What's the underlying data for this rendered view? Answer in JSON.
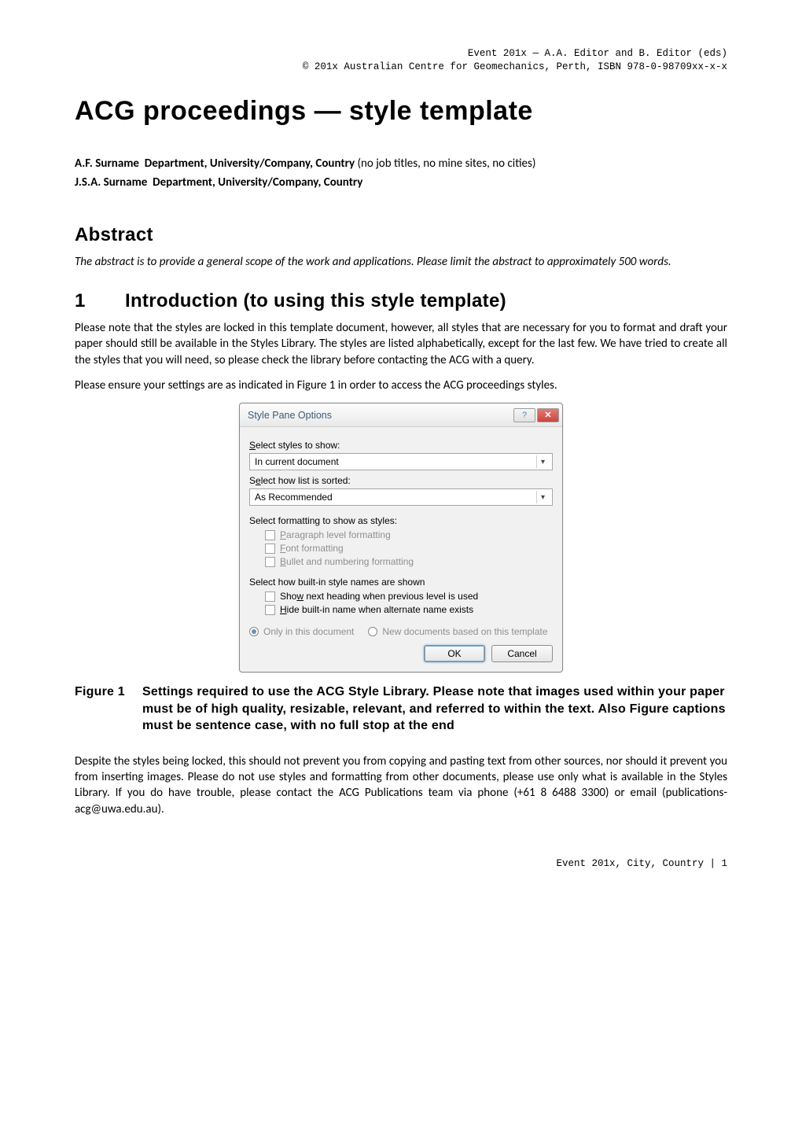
{
  "header": {
    "line1_prefix": "Event 201x ",
    "line1_dash": "—",
    "line1_suffix": " A.A. Editor and B. Editor (eds)",
    "line2": "© 201x Australian Centre for Geomechanics, Perth, ISBN 978-0-98709xx-x-x"
  },
  "title": "ACG proceedings — style template",
  "authors": [
    {
      "name": "A.F. Surname",
      "affiliation": "Department, University/Company, Country",
      "note": " (no job titles, no mine sites, no cities)"
    },
    {
      "name": "J.S.A. Surname",
      "affiliation": "Department, University/Company, Country",
      "note": ""
    }
  ],
  "abstract": {
    "heading": "Abstract",
    "text": "The abstract is to provide a general scope of the work and applications. Please limit the abstract to approximately 500 words."
  },
  "section1": {
    "number": "1",
    "heading": "Introduction (to using this style template)",
    "p1": "Please note that the styles are locked in this template document, however, all styles that are necessary for you to format and draft your paper should still be available in the Styles Library. The styles are listed alphabetically, except for the last few. We have tried to create all the styles that you will need, so please check the library before contacting the ACG with a query.",
    "p2": "Please ensure your settings are as indicated in Figure 1 in order to access the ACG proceedings styles."
  },
  "dialog": {
    "title": "Style Pane Options",
    "help_icon": "?",
    "close_icon": "✕",
    "label_select_styles_pre": "S",
    "label_select_styles_rest": "elect styles to show:",
    "select1_value": "In current document",
    "label_sort_pre": "S",
    "label_sort_mid": "e",
    "label_sort_rest": "lect how list is sorted:",
    "label_sort_full": "Select how list is sorted:",
    "select2_value": "As Recommended",
    "group_formatting": "Select formatting to show as styles:",
    "chk_paragraph": "Paragraph level formatting",
    "chk_font": "Font formatting",
    "chk_bullet": "Bullet and numbering formatting",
    "group_builtin": "Select how built-in style names are shown",
    "chk_show_next": "Show next heading when previous level is used",
    "chk_hide_builtin": "Hide built-in name when alternate name exists",
    "radio_only": "Only in this document",
    "radio_new": "New documents based on this template",
    "btn_ok": "OK",
    "btn_cancel": "Cancel"
  },
  "figure1": {
    "label": "Figure 1",
    "caption": "Settings required to use the ACG Style Library. Please note that images used within your paper must be of high quality, resizable, relevant, and referred to within the text. Also Figure captions must be sentence case, with no full stop at the end"
  },
  "closing": {
    "p": "Despite the styles being locked, this should not prevent you from copying and pasting text from other sources, nor should it prevent you from inserting images. Please do not use styles and formatting from other documents, please use only what is available in the Styles Library. If you do have trouble, please contact the ACG Publications team via phone (+61 8 6488 3300) or email (publications-acg@uwa.edu.au)."
  },
  "footer": {
    "text": "Event 201x, City, Country | 1"
  }
}
